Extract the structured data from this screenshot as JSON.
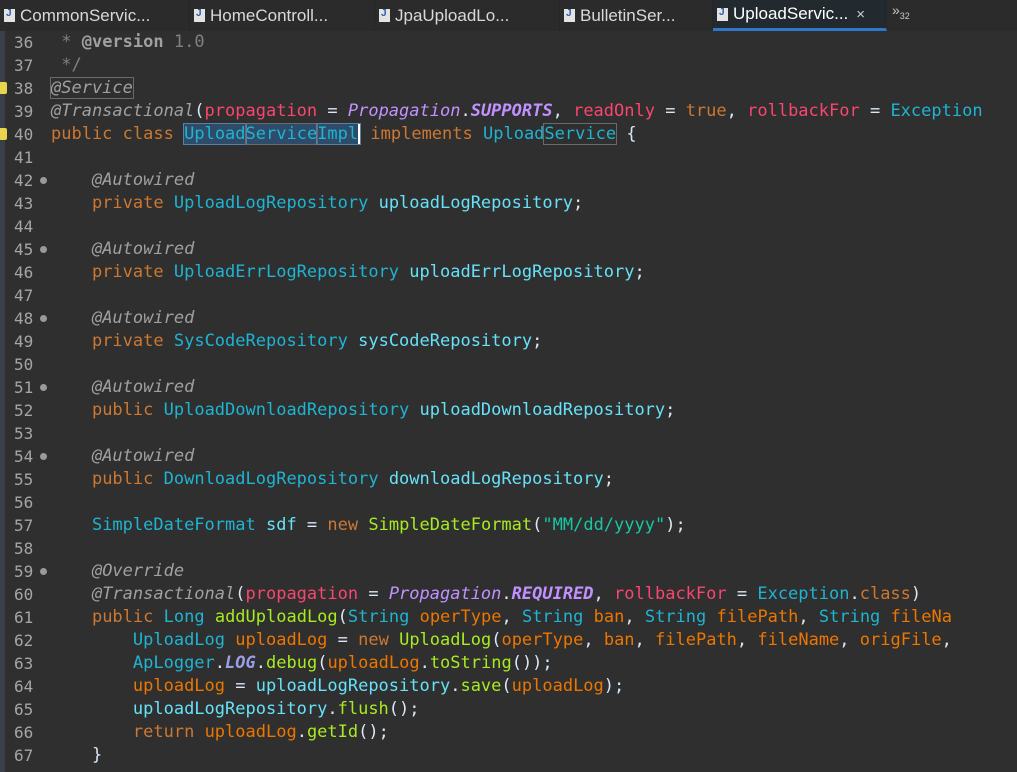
{
  "tabs": [
    {
      "label": "CommonServic...",
      "icon": "java-file-icon",
      "active": false
    },
    {
      "label": "HomeControll...",
      "icon": "java-file-icon",
      "active": false
    },
    {
      "label": "JpaUploadLo...",
      "icon": "java-file-icon",
      "active": false
    },
    {
      "label": "BulletinSer...",
      "icon": "java-file-icon",
      "active": false
    },
    {
      "label": "UploadServic...",
      "icon": "java-file-icon",
      "active": true,
      "close": "×"
    }
  ],
  "overflow": {
    "chevron": "»",
    "count": "32"
  },
  "editor": {
    "lines": [
      {
        "n": "36",
        "t": [
          [
            "cmt",
            " * "
          ],
          [
            "cmtb",
            "@version"
          ],
          [
            "cmt",
            " 1.0"
          ]
        ]
      },
      {
        "n": "37",
        "t": [
          [
            "cmt",
            " */"
          ]
        ]
      },
      {
        "n": "38",
        "mark": true,
        "t": [
          [
            "ann occ",
            "@Service"
          ]
        ]
      },
      {
        "n": "39",
        "t": [
          [
            "ann",
            "@Transactional"
          ],
          [
            "",
            "("
          ],
          [
            "red",
            "propagation"
          ],
          [
            "",
            " = "
          ],
          [
            "enm",
            "Propagation"
          ],
          [
            "",
            "."
          ],
          [
            "enmb",
            "SUPPORTS"
          ],
          [
            "",
            ", "
          ],
          [
            "red",
            "readOnly"
          ],
          [
            "",
            " = "
          ],
          [
            "kw",
            "true"
          ],
          [
            "",
            ", "
          ],
          [
            "red",
            "rollbackFor"
          ],
          [
            "",
            " = "
          ],
          [
            "type",
            "Exception"
          ]
        ]
      },
      {
        "n": "40",
        "mark": true,
        "t": [
          [
            "kw",
            "public"
          ],
          [
            "",
            " "
          ],
          [
            "kw",
            "class"
          ],
          [
            "",
            " "
          ],
          [
            "type sel",
            "Upload"
          ],
          [
            "type sel occ",
            "Service"
          ],
          [
            "type sel caret",
            "Impl"
          ],
          [
            "",
            " "
          ],
          [
            "kw",
            "implements"
          ],
          [
            "",
            " "
          ],
          [
            "type",
            "Upload"
          ],
          [
            "type occ",
            "Service"
          ],
          [
            "",
            " {"
          ]
        ]
      },
      {
        "n": "41",
        "t": []
      },
      {
        "n": "42",
        "fold": true,
        "t": [
          [
            "",
            "    "
          ],
          [
            "ann",
            "@Autowired"
          ]
        ]
      },
      {
        "n": "43",
        "t": [
          [
            "",
            "    "
          ],
          [
            "kw",
            "private"
          ],
          [
            "",
            " "
          ],
          [
            "type",
            "UploadLogRepository"
          ],
          [
            "",
            " "
          ],
          [
            "fld",
            "uploadLogRepository"
          ],
          [
            "",
            ";"
          ]
        ]
      },
      {
        "n": "44",
        "t": []
      },
      {
        "n": "45",
        "fold": true,
        "t": [
          [
            "",
            "    "
          ],
          [
            "ann",
            "@Autowired"
          ]
        ]
      },
      {
        "n": "46",
        "t": [
          [
            "",
            "    "
          ],
          [
            "kw",
            "private"
          ],
          [
            "",
            " "
          ],
          [
            "type",
            "UploadErrLogRepository"
          ],
          [
            "",
            " "
          ],
          [
            "fld",
            "uploadErrLogRepository"
          ],
          [
            "",
            ";"
          ]
        ]
      },
      {
        "n": "47",
        "t": []
      },
      {
        "n": "48",
        "fold": true,
        "t": [
          [
            "",
            "    "
          ],
          [
            "ann",
            "@Autowired"
          ]
        ]
      },
      {
        "n": "49",
        "t": [
          [
            "",
            "    "
          ],
          [
            "kw",
            "private"
          ],
          [
            "",
            " "
          ],
          [
            "type",
            "SysCodeRepository"
          ],
          [
            "",
            " "
          ],
          [
            "fld",
            "sysCodeRepository"
          ],
          [
            "",
            ";"
          ]
        ]
      },
      {
        "n": "50",
        "t": []
      },
      {
        "n": "51",
        "fold": true,
        "t": [
          [
            "",
            "    "
          ],
          [
            "ann",
            "@Autowired"
          ]
        ]
      },
      {
        "n": "52",
        "t": [
          [
            "",
            "    "
          ],
          [
            "kw",
            "public"
          ],
          [
            "",
            " "
          ],
          [
            "type",
            "UploadDownloadRepository"
          ],
          [
            "",
            " "
          ],
          [
            "fld",
            "uploadDownloadRepository"
          ],
          [
            "",
            ";"
          ]
        ]
      },
      {
        "n": "53",
        "t": []
      },
      {
        "n": "54",
        "fold": true,
        "t": [
          [
            "",
            "    "
          ],
          [
            "ann",
            "@Autowired"
          ]
        ]
      },
      {
        "n": "55",
        "t": [
          [
            "",
            "    "
          ],
          [
            "kw",
            "public"
          ],
          [
            "",
            " "
          ],
          [
            "type",
            "DownloadLogRepository"
          ],
          [
            "",
            " "
          ],
          [
            "fld",
            "downloadLogRepository"
          ],
          [
            "",
            ";"
          ]
        ]
      },
      {
        "n": "56",
        "t": []
      },
      {
        "n": "57",
        "t": [
          [
            "",
            "    "
          ],
          [
            "type",
            "SimpleDateFormat"
          ],
          [
            "",
            " "
          ],
          [
            "fld",
            "sdf"
          ],
          [
            "",
            " = "
          ],
          [
            "kw",
            "new"
          ],
          [
            "",
            " "
          ],
          [
            "mth",
            "SimpleDateFormat"
          ],
          [
            "",
            "("
          ],
          [
            "str",
            "\"MM/dd/yyyy\""
          ],
          [
            "",
            ");"
          ]
        ]
      },
      {
        "n": "58",
        "t": []
      },
      {
        "n": "59",
        "fold": true,
        "t": [
          [
            "",
            "    "
          ],
          [
            "ann",
            "@Override"
          ]
        ]
      },
      {
        "n": "60",
        "t": [
          [
            "",
            "    "
          ],
          [
            "ann",
            "@Transactional"
          ],
          [
            "",
            "("
          ],
          [
            "red",
            "propagation"
          ],
          [
            "",
            " = "
          ],
          [
            "enm",
            "Propagation"
          ],
          [
            "",
            "."
          ],
          [
            "enmb",
            "REQUIRED"
          ],
          [
            "",
            ", "
          ],
          [
            "red",
            "rollbackFor"
          ],
          [
            "",
            " = "
          ],
          [
            "type",
            "Exception"
          ],
          [
            "",
            "."
          ],
          [
            "kw",
            "class"
          ],
          [
            "",
            ")"
          ]
        ]
      },
      {
        "n": "61",
        "t": [
          [
            "",
            "    "
          ],
          [
            "kw",
            "public"
          ],
          [
            "",
            " "
          ],
          [
            "type",
            "Long"
          ],
          [
            "",
            " "
          ],
          [
            "mth",
            "addUploadLog"
          ],
          [
            "",
            "("
          ],
          [
            "type",
            "String"
          ],
          [
            "",
            " "
          ],
          [
            "prm",
            "operType"
          ],
          [
            "",
            ", "
          ],
          [
            "type",
            "String"
          ],
          [
            "",
            " "
          ],
          [
            "prm",
            "ban"
          ],
          [
            "",
            ", "
          ],
          [
            "type",
            "String"
          ],
          [
            "",
            " "
          ],
          [
            "prm",
            "filePath"
          ],
          [
            "",
            ", "
          ],
          [
            "type",
            "String"
          ],
          [
            "",
            " "
          ],
          [
            "prm",
            "fileNa"
          ]
        ]
      },
      {
        "n": "62",
        "t": [
          [
            "",
            "        "
          ],
          [
            "type",
            "UploadLog"
          ],
          [
            "",
            " "
          ],
          [
            "prm",
            "uploadLog"
          ],
          [
            "",
            " = "
          ],
          [
            "kw",
            "new"
          ],
          [
            "",
            " "
          ],
          [
            "mth",
            "UploadLog"
          ],
          [
            "",
            "("
          ],
          [
            "prm",
            "operType"
          ],
          [
            "",
            ", "
          ],
          [
            "prm",
            "ban"
          ],
          [
            "",
            ", "
          ],
          [
            "prm",
            "filePath"
          ],
          [
            "",
            ", "
          ],
          [
            "prm",
            "fileName"
          ],
          [
            "",
            ", "
          ],
          [
            "prm",
            "origFile"
          ],
          [
            "",
            ","
          ]
        ]
      },
      {
        "n": "63",
        "t": [
          [
            "",
            "        "
          ],
          [
            "type",
            "ApLogger"
          ],
          [
            "",
            "."
          ],
          [
            "stat",
            "LOG"
          ],
          [
            "",
            "."
          ],
          [
            "mth",
            "debug"
          ],
          [
            "",
            "("
          ],
          [
            "prm",
            "uploadLog"
          ],
          [
            "",
            "."
          ],
          [
            "mth",
            "toString"
          ],
          [
            "",
            "());"
          ]
        ]
      },
      {
        "n": "64",
        "t": [
          [
            "",
            "        "
          ],
          [
            "prm",
            "uploadLog"
          ],
          [
            "",
            " = "
          ],
          [
            "fld",
            "uploadLogRepository"
          ],
          [
            "",
            "."
          ],
          [
            "mth",
            "save"
          ],
          [
            "",
            "("
          ],
          [
            "prm",
            "uploadLog"
          ],
          [
            "",
            ");"
          ]
        ]
      },
      {
        "n": "65",
        "t": [
          [
            "",
            "        "
          ],
          [
            "fld",
            "uploadLogRepository"
          ],
          [
            "",
            "."
          ],
          [
            "mth",
            "flush"
          ],
          [
            "",
            "();"
          ]
        ]
      },
      {
        "n": "66",
        "t": [
          [
            "",
            "        "
          ],
          [
            "kw",
            "return"
          ],
          [
            "",
            " "
          ],
          [
            "prm",
            "uploadLog"
          ],
          [
            "",
            "."
          ],
          [
            "mth",
            "getId"
          ],
          [
            "",
            "();"
          ]
        ]
      },
      {
        "n": "67",
        "t": [
          [
            "",
            "    }"
          ]
        ]
      }
    ]
  }
}
